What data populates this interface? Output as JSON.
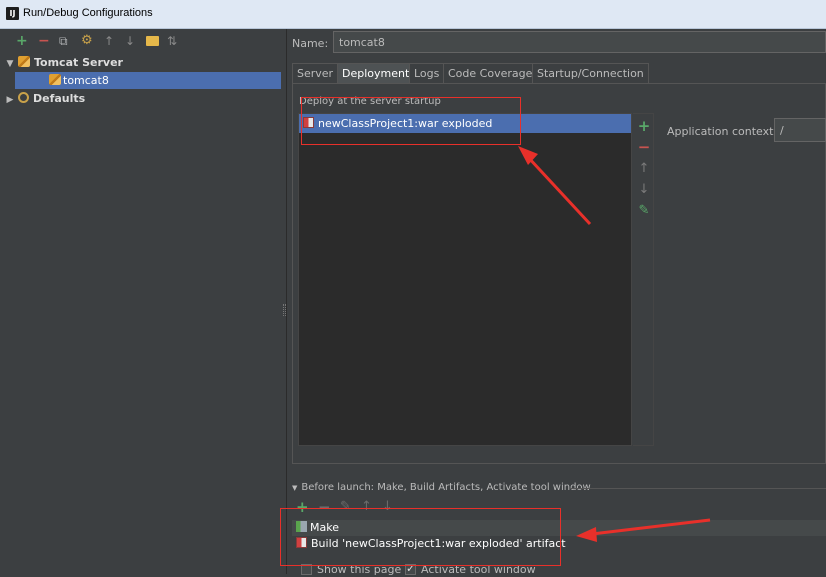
{
  "window": {
    "title": "Run/Debug Configurations",
    "icon": "intellij-icon",
    "icon_text": "IJ"
  },
  "toolbar": {
    "icons": [
      {
        "name": "add-icon",
        "glyph": "+",
        "color": "#59a869"
      },
      {
        "name": "remove-icon",
        "glyph": "−",
        "color": "#c75450"
      },
      {
        "name": "copy-icon",
        "glyph": "⧉",
        "color": "#afb1b3"
      },
      {
        "name": "settings-icon",
        "glyph": "⚙",
        "color": "#c9a24a"
      },
      {
        "name": "move-up-icon",
        "glyph": "↑",
        "color": "#8a8a8a"
      },
      {
        "name": "move-down-icon",
        "glyph": "↓",
        "color": "#8a8a8a"
      },
      {
        "name": "folder-icon",
        "glyph": "▬",
        "color": "#e6b84a"
      },
      {
        "name": "sort-icon",
        "glyph": "⇅",
        "color": "#8a8a8a"
      }
    ]
  },
  "tree": {
    "tomcat_server": "Tomcat Server",
    "tomcat8": "tomcat8",
    "defaults": "Defaults"
  },
  "name_field": {
    "label": "Name:",
    "value": "tomcat8"
  },
  "tabs": [
    {
      "label": "Server",
      "active": false
    },
    {
      "label": "Deployment",
      "active": true
    },
    {
      "label": "Logs",
      "active": false
    },
    {
      "label": "Code Coverage",
      "active": false
    },
    {
      "label": "Startup/Connection",
      "active": false
    }
  ],
  "deployment": {
    "section_title": "Deploy at the server startup",
    "items": [
      "newClassProject1:war exploded"
    ],
    "side_icons": [
      {
        "name": "add-icon",
        "glyph": "+",
        "color": "#59a869"
      },
      {
        "name": "remove-icon",
        "glyph": "−",
        "color": "#c75450"
      },
      {
        "name": "move-up-icon",
        "glyph": "↑",
        "color": "#7a7a7a"
      },
      {
        "name": "move-down-icon",
        "glyph": "↓",
        "color": "#7a7a7a"
      },
      {
        "name": "edit-icon",
        "glyph": "✎",
        "color": "#59a869"
      }
    ],
    "context_label": "Application context:",
    "context_value": "/"
  },
  "before_launch": {
    "title": "Before launch: Make, Build Artifacts, Activate tool window",
    "tools": [
      {
        "name": "add-icon",
        "glyph": "+",
        "color": "#59a869"
      },
      {
        "name": "remove-icon",
        "glyph": "−",
        "color": "#6b6b6b"
      },
      {
        "name": "edit-icon",
        "glyph": "✎",
        "color": "#6b6b6b"
      },
      {
        "name": "move-up-icon",
        "glyph": "↑",
        "color": "#6b6b6b"
      },
      {
        "name": "move-down-icon",
        "glyph": "↓",
        "color": "#6b6b6b"
      }
    ],
    "items": [
      "Make",
      "Build 'newClassProject1:war exploded' artifact"
    ]
  },
  "options": {
    "show_page": {
      "label": "Show this page",
      "checked": false
    },
    "activate_tool": {
      "label": "Activate tool window",
      "checked": true
    }
  },
  "colors": {
    "selection": "#4b6eaf",
    "annotation": "#e8302a",
    "background": "#3c3f41"
  }
}
